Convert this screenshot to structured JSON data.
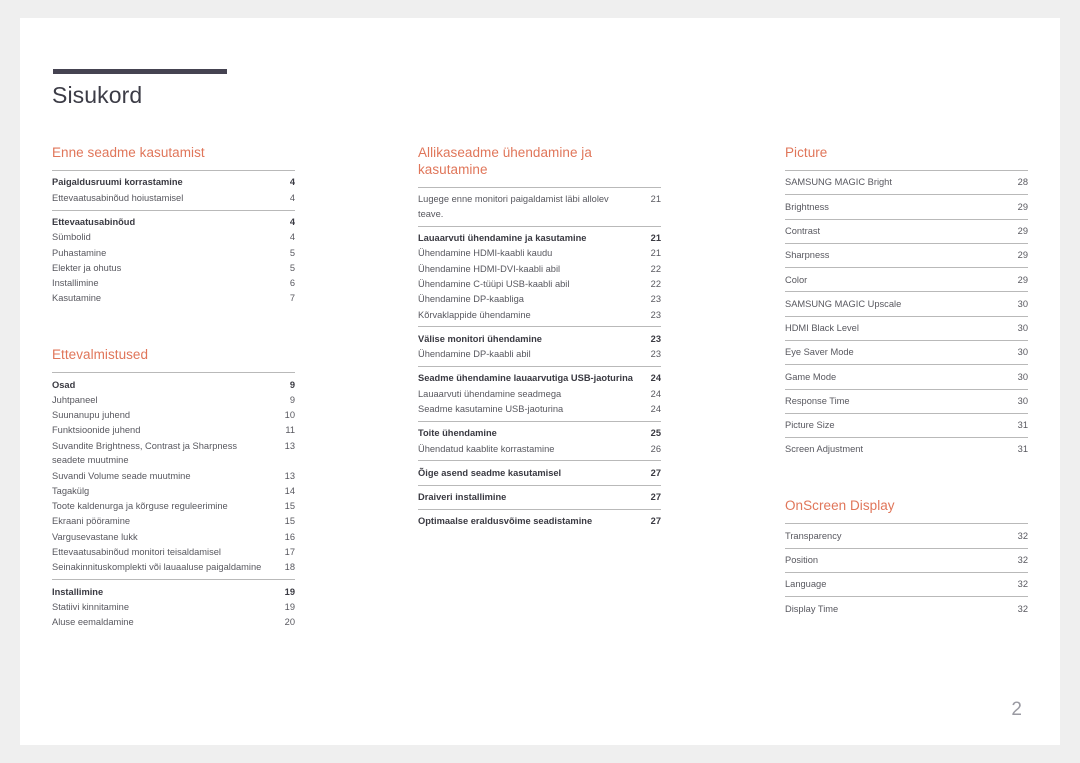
{
  "document": {
    "title": "Sisukord",
    "page_number": "2",
    "accent_color": "#e0765a",
    "rule_color": "#454351"
  },
  "columns": [
    {
      "sections": [
        {
          "heading": "Enne seadme kasutamist",
          "groups": [
            {
              "entries": [
                {
                  "label": "Paigaldusruumi korrastamine",
                  "page": "4",
                  "bold": true
                },
                {
                  "label": "Ettevaatusabinõud hoiustamisel",
                  "page": "4",
                  "bold": false
                }
              ]
            },
            {
              "entries": [
                {
                  "label": "Ettevaatusabinõud",
                  "page": "4",
                  "bold": true
                },
                {
                  "label": "Sümbolid",
                  "page": "4",
                  "bold": false
                },
                {
                  "label": "Puhastamine",
                  "page": "5",
                  "bold": false
                },
                {
                  "label": "Elekter ja ohutus",
                  "page": "5",
                  "bold": false
                },
                {
                  "label": "Installimine",
                  "page": "6",
                  "bold": false
                },
                {
                  "label": "Kasutamine",
                  "page": "7",
                  "bold": false
                }
              ]
            }
          ]
        },
        {
          "heading": "Ettevalmistused",
          "groups": [
            {
              "entries": [
                {
                  "label": "Osad",
                  "page": "9",
                  "bold": true
                },
                {
                  "label": "Juhtpaneel",
                  "page": "9",
                  "bold": false
                },
                {
                  "label": "Suunanupu juhend",
                  "page": "10",
                  "bold": false
                },
                {
                  "label": "Funktsioonide juhend",
                  "page": "11",
                  "bold": false
                },
                {
                  "label": "Suvandite Brightness, Contrast ja Sharpness seadete muutmine",
                  "page": "13",
                  "bold": false
                },
                {
                  "label": "Suvandi Volume seade muutmine",
                  "page": "13",
                  "bold": false
                },
                {
                  "label": "Tagakülg",
                  "page": "14",
                  "bold": false
                },
                {
                  "label": "Toote kaldenurga ja kõrguse reguleerimine",
                  "page": "15",
                  "bold": false
                },
                {
                  "label": "Ekraani pööramine",
                  "page": "15",
                  "bold": false
                },
                {
                  "label": "Vargusevastane lukk",
                  "page": "16",
                  "bold": false
                },
                {
                  "label": "Ettevaatusabinõud monitori teisaldamisel",
                  "page": "17",
                  "bold": false
                },
                {
                  "label": "Seinakinnituskomplekti või lauaaluse paigaldamine",
                  "page": "18",
                  "bold": false
                }
              ]
            },
            {
              "entries": [
                {
                  "label": "Installimine",
                  "page": "19",
                  "bold": true
                },
                {
                  "label": "Statiivi kinnitamine",
                  "page": "19",
                  "bold": false
                },
                {
                  "label": "Aluse eemaldamine",
                  "page": "20",
                  "bold": false
                }
              ]
            }
          ]
        }
      ]
    },
    {
      "sections": [
        {
          "heading": "Allikaseadme ühendamine ja kasutamine",
          "groups": [
            {
              "entries": [
                {
                  "label": "Lugege enne monitori paigaldamist läbi allolev teave.",
                  "page": "21",
                  "bold": false
                }
              ]
            },
            {
              "entries": [
                {
                  "label": "Lauaarvuti ühendamine ja kasutamine",
                  "page": "21",
                  "bold": true
                },
                {
                  "label": "Ühendamine HDMI-kaabli kaudu",
                  "page": "21",
                  "bold": false
                },
                {
                  "label": "Ühendamine HDMI-DVI-kaabli abil",
                  "page": "22",
                  "bold": false
                },
                {
                  "label": "Ühendamine C-tüüpi USB-kaabli abil",
                  "page": "22",
                  "bold": false
                },
                {
                  "label": "Ühendamine DP-kaabliga",
                  "page": "23",
                  "bold": false
                },
                {
                  "label": "Kõrvaklappide ühendamine",
                  "page": "23",
                  "bold": false
                }
              ]
            },
            {
              "entries": [
                {
                  "label": "Välise monitori ühendamine",
                  "page": "23",
                  "bold": true
                },
                {
                  "label": "Ühendamine DP-kaabli abil",
                  "page": "23",
                  "bold": false
                }
              ]
            },
            {
              "entries": [
                {
                  "label": "Seadme ühendamine lauaarvutiga USB-jaoturina",
                  "page": "24",
                  "bold": true
                },
                {
                  "label": "Lauaarvuti ühendamine seadmega",
                  "page": "24",
                  "bold": false
                },
                {
                  "label": "Seadme kasutamine USB-jaoturina",
                  "page": "24",
                  "bold": false
                }
              ]
            },
            {
              "entries": [
                {
                  "label": "Toite ühendamine",
                  "page": "25",
                  "bold": true
                },
                {
                  "label": "Ühendatud kaablite korrastamine",
                  "page": "26",
                  "bold": false
                }
              ]
            },
            {
              "entries": [
                {
                  "label": "Õige asend seadme kasutamisel",
                  "page": "27",
                  "bold": true
                }
              ]
            },
            {
              "entries": [
                {
                  "label": "Draiveri installimine",
                  "page": "27",
                  "bold": true
                }
              ]
            },
            {
              "entries": [
                {
                  "label": "Optimaalse eraldusvõime seadistamine",
                  "page": "27",
                  "bold": true
                }
              ]
            }
          ]
        }
      ]
    },
    {
      "sections": [
        {
          "heading": "Picture",
          "groups": [
            {
              "entries": [
                {
                  "label": "SAMSUNG MAGIC Bright",
                  "page": "28",
                  "bold": false
                }
              ]
            },
            {
              "entries": [
                {
                  "label": "Brightness",
                  "page": "29",
                  "bold": false
                }
              ]
            },
            {
              "entries": [
                {
                  "label": "Contrast",
                  "page": "29",
                  "bold": false
                }
              ]
            },
            {
              "entries": [
                {
                  "label": "Sharpness",
                  "page": "29",
                  "bold": false
                }
              ]
            },
            {
              "entries": [
                {
                  "label": "Color",
                  "page": "29",
                  "bold": false
                }
              ]
            },
            {
              "entries": [
                {
                  "label": "SAMSUNG MAGIC Upscale",
                  "page": "30",
                  "bold": false
                }
              ]
            },
            {
              "entries": [
                {
                  "label": "HDMI Black Level",
                  "page": "30",
                  "bold": false
                }
              ]
            },
            {
              "entries": [
                {
                  "label": "Eye Saver Mode",
                  "page": "30",
                  "bold": false
                }
              ]
            },
            {
              "entries": [
                {
                  "label": "Game Mode",
                  "page": "30",
                  "bold": false
                }
              ]
            },
            {
              "entries": [
                {
                  "label": "Response Time",
                  "page": "30",
                  "bold": false
                }
              ]
            },
            {
              "entries": [
                {
                  "label": "Picture Size",
                  "page": "31",
                  "bold": false
                }
              ]
            },
            {
              "entries": [
                {
                  "label": "Screen Adjustment",
                  "page": "31",
                  "bold": false
                }
              ]
            }
          ]
        },
        {
          "heading": "OnScreen Display",
          "groups": [
            {
              "entries": [
                {
                  "label": "Transparency",
                  "page": "32",
                  "bold": false
                }
              ]
            },
            {
              "entries": [
                {
                  "label": "Position",
                  "page": "32",
                  "bold": false
                }
              ]
            },
            {
              "entries": [
                {
                  "label": "Language",
                  "page": "32",
                  "bold": false
                }
              ]
            },
            {
              "entries": [
                {
                  "label": "Display Time",
                  "page": "32",
                  "bold": false
                }
              ]
            }
          ]
        }
      ]
    }
  ]
}
